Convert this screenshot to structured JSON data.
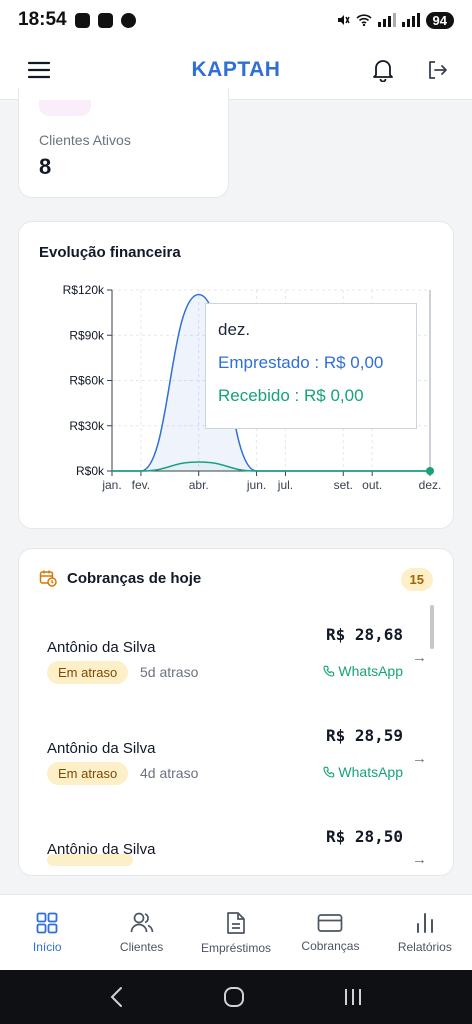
{
  "status_bar": {
    "time": "18:54",
    "battery": "94"
  },
  "header": {
    "title": "KAPTAH",
    "menu_icon": "menu-icon",
    "bell_icon": "bell-icon",
    "logout_icon": "logout-icon"
  },
  "clients_card": {
    "label": "Clientes Ativos",
    "value": "8"
  },
  "chart_card": {
    "title": "Evolução financeira"
  },
  "chart_data": {
    "type": "area",
    "title": "Evolução financeira",
    "categories": [
      "jan.",
      "fev.",
      "abr.",
      "jun.",
      "jul.",
      "set.",
      "out.",
      "dez."
    ],
    "y_ticks": [
      "R$0k",
      "R$30k",
      "R$60k",
      "R$90k",
      "R$120k"
    ],
    "ylim": [
      0,
      120000
    ],
    "grid": true,
    "series": [
      {
        "name": "Emprestado",
        "color": "#2f6fd6",
        "x": [
          "jan.",
          "fev.",
          "abr.",
          "jun.",
          "jul.",
          "set.",
          "out.",
          "dez."
        ],
        "values": [
          0,
          0,
          117000,
          0,
          0,
          0,
          0,
          0
        ]
      },
      {
        "name": "Recebido",
        "color": "#16a37a",
        "x": [
          "jan.",
          "fev.",
          "abr.",
          "jun.",
          "jul.",
          "set.",
          "out.",
          "dez."
        ],
        "values": [
          0,
          0,
          6000,
          0,
          0,
          0,
          0,
          0
        ]
      }
    ],
    "tooltip": {
      "title": "dez.",
      "lines": [
        "Emprestado : R$ 0,00",
        "Recebido : R$ 0,00"
      ]
    }
  },
  "charges": {
    "title": "Cobranças de hoje",
    "count": "15",
    "items": [
      {
        "name": "Antônio da Silva",
        "status": "Em atraso",
        "late": "5d atraso",
        "amount": "R$ 28,68",
        "whatsapp": "WhatsApp"
      },
      {
        "name": "Antônio da Silva",
        "status": "Em atraso",
        "late": "4d atraso",
        "amount": "R$ 28,59",
        "whatsapp": "WhatsApp"
      },
      {
        "name": "Antônio da Silva",
        "status": "",
        "late": "",
        "amount": "R$ 28,50",
        "whatsapp": ""
      }
    ]
  },
  "bottom_nav": [
    {
      "label": "Início",
      "icon": "dashboard-icon",
      "active": true
    },
    {
      "label": "Clientes",
      "icon": "users-icon",
      "active": false
    },
    {
      "label": "Empréstimos",
      "icon": "document-icon",
      "active": false
    },
    {
      "label": "Cobranças",
      "icon": "card-icon",
      "active": false
    },
    {
      "label": "Relatórios",
      "icon": "bar-chart-icon",
      "active": false
    }
  ],
  "colors": {
    "brand": "#2f6fd6",
    "received": "#16a37a",
    "warning_bg": "#fdefc8"
  }
}
